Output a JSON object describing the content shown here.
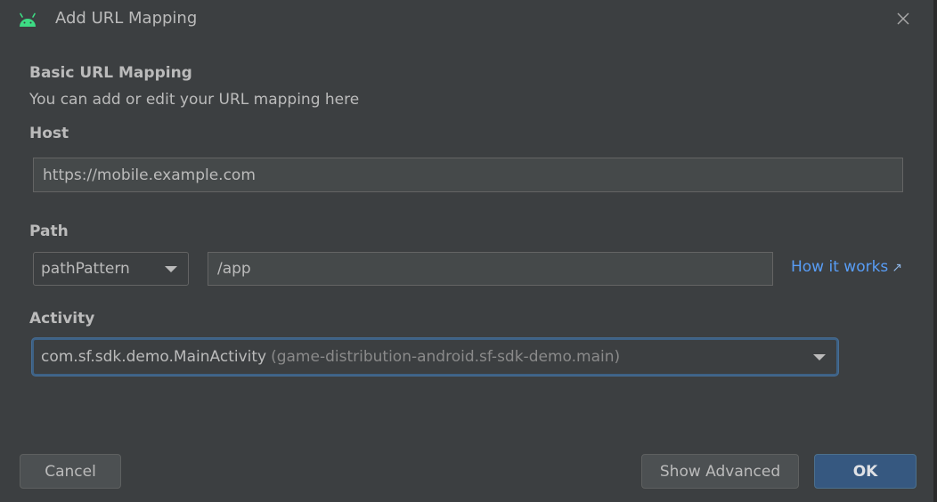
{
  "dialog": {
    "title": "Add URL Mapping",
    "close_icon": "close-icon",
    "app_icon": "android-icon"
  },
  "basic": {
    "heading": "Basic URL Mapping",
    "description": "You can add or edit your URL mapping here"
  },
  "host": {
    "label": "Host",
    "value": "https://mobile.example.com"
  },
  "path": {
    "label": "Path",
    "type_selected": "pathPattern",
    "value": "/app",
    "help_link": "How it works",
    "help_icon": "external-link-arrow-icon"
  },
  "activity": {
    "label": "Activity",
    "selected_class": "com.sf.sdk.demo.MainActivity",
    "selected_module": "(game-distribution-android.sf-sdk-demo.main)"
  },
  "buttons": {
    "cancel": "Cancel",
    "show_advanced": "Show Advanced",
    "ok": "OK"
  },
  "colors": {
    "background": "#3c3f41",
    "link": "#589df6",
    "primary_button": "#365880",
    "android_green": "#3ddc84"
  }
}
